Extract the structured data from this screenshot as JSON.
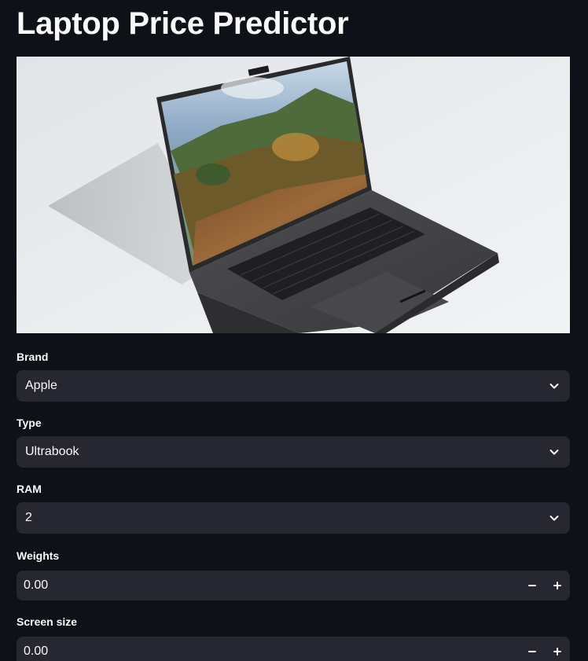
{
  "title": "Laptop Price Predictor",
  "hero_image": {
    "icon": "laptop-photo"
  },
  "fields": {
    "brand": {
      "label": "Brand",
      "value": "Apple",
      "icon": "chevron-down-icon"
    },
    "type": {
      "label": "Type",
      "value": "Ultrabook",
      "icon": "chevron-down-icon"
    },
    "ram": {
      "label": "RAM",
      "value": "2",
      "icon": "chevron-down-icon"
    },
    "weights": {
      "label": "Weights",
      "value": "0.00",
      "decrement_icon": "minus-icon",
      "increment_icon": "plus-icon"
    },
    "screen_size": {
      "label": "Screen size",
      "value": "0.00",
      "decrement_icon": "minus-icon",
      "increment_icon": "plus-icon"
    }
  },
  "colors": {
    "background": "#0e1117",
    "widget": "#262730",
    "text": "#fafafa"
  }
}
